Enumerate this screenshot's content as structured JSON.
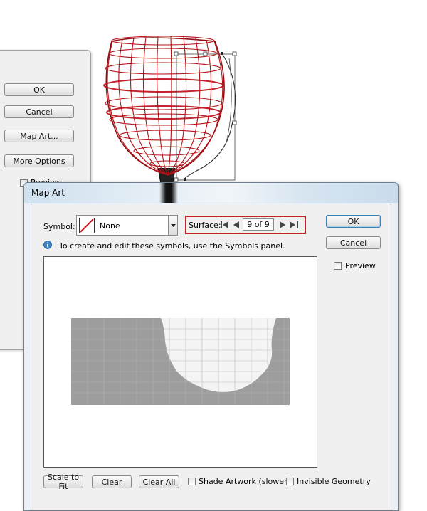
{
  "back_dialog": {
    "ok_label": "OK",
    "cancel_label": "Cancel",
    "map_art_label": "Map Art...",
    "more_options_label": "More Options",
    "preview_label": "Preview"
  },
  "map_art": {
    "title": "Map Art",
    "symbol_label": "Symbol:",
    "symbol_value": "None",
    "surface_label": "Surface:",
    "surface_value": "9 of 9",
    "info_text": "To create and edit these symbols, use the Symbols panel.",
    "ok_label": "OK",
    "cancel_label": "Cancel",
    "preview_label": "Preview",
    "scale_to_fit_label": "Scale to Fit",
    "clear_label": "Clear",
    "clear_all_label": "Clear All",
    "shade_artwork_label": "Shade Artwork (slower)",
    "invisible_geometry_label": "Invisible Geometry"
  },
  "colors": {
    "wireframe": "#b31217",
    "surface_highlight": "#c3212b",
    "map_surface_gray": "#9d9d9d"
  }
}
